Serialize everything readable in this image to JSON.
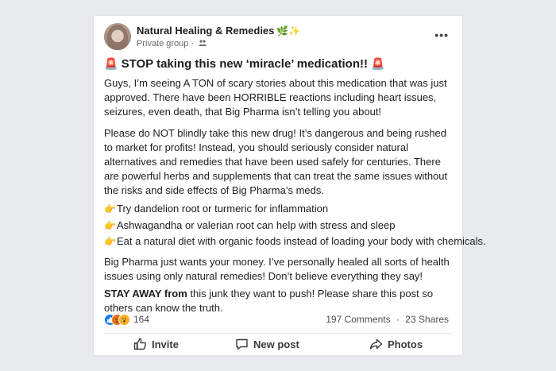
{
  "group": {
    "name": "Natural Healing & Remedies",
    "name_emoji": "🌿✨",
    "privacy": "Private group ·",
    "privacy_icon": "people-icon"
  },
  "post": {
    "siren_left": "🚨",
    "title": "STOP taking this new ‘miracle’ medication!!",
    "siren_right": "🚨",
    "paragraph1": "Guys, I’m seeing A TON of scary stories about this medication that was just approved. There have been HORRIBLE reactions including heart issues, seizures, even death, that Big Pharma isn’t telling you about!",
    "paragraph2": "Please do NOT blindly take this new drug! It’s dangerous and being rushed to market for profits! Instead, you should seriously consider natural alternatives and remedies that have been used safely for centuries. There are powerful herbs and supplements that can treat the same issues without the risks and side effects of Big Pharma’s meds.",
    "bullet_icon": "👉",
    "bullets": [
      "Try dandelion root or turmeric for inflammation",
      "Ashwagandha or valerian root can help with stress and sleep",
      "Eat a natural diet with organic foods instead of loading your body with chemicals."
    ],
    "paragraph3": "Big Pharma just wants your money. I’ve personally healed all sorts of health issues using only natural remedies! Don’t believe everything they say!",
    "paragraph4_bold": "STAY AWAY from",
    "paragraph4_rest": " this junk they want to push! Please share this post so others can know the truth."
  },
  "stats": {
    "reaction_icons": [
      "like-icon",
      "angry-icon",
      "wow-icon"
    ],
    "reaction_count": "164",
    "comments": "197 Comments",
    "separator": "·",
    "shares": "23 Shares"
  },
  "actions": {
    "invite": "Invite",
    "new_post": "New post",
    "photos": "Photos"
  },
  "colors": {
    "background": "#e9eaed",
    "card": "#ffffff",
    "like_blue": "#1877f2",
    "angry_orange": "#e9710f",
    "wow_yellow": "#f7b125"
  }
}
